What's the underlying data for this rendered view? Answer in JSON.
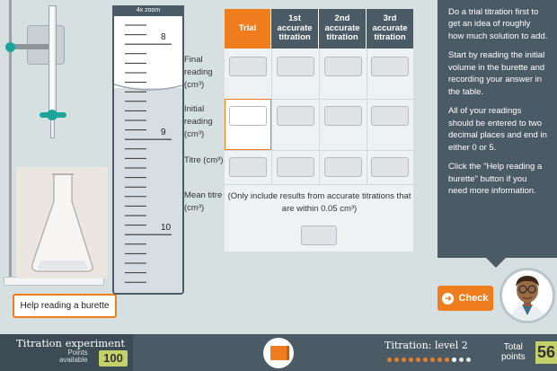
{
  "zoom": {
    "title": "4x zoom",
    "tick_labels": [
      "8",
      "9",
      "10"
    ]
  },
  "help_button": {
    "label": "Help reading a burette"
  },
  "table": {
    "headers": [
      "Trial",
      "1st accurate titration",
      "2nd accurate titration",
      "3rd accurate titration"
    ],
    "row_labels": {
      "final": "Final reading (cm³)",
      "initial": "Initial reading (cm³)",
      "titre": "Titre (cm³)",
      "mean": "Mean titre (cm³)"
    },
    "note": "(Only include results from accurate titrations that are within 0.05 cm³)",
    "values": {
      "final": [
        "",
        "",
        "",
        ""
      ],
      "initial": [
        "",
        "",
        "",
        ""
      ],
      "titre": [
        "",
        "",
        "",
        ""
      ],
      "mean": ""
    },
    "active_cell": "initial-trial"
  },
  "instructions": [
    "Do a trial titration first to get an idea of roughly how much solution to add.",
    "Start by reading the initial volume in the burette and recording your answer in the table.",
    "All of your readings should be entered to two decimal places and end in either 0 or 5.",
    "Click the \"Help reading a burette\" button if you need more information."
  ],
  "check_button": {
    "label": "Check",
    "icon": "arrow-right-icon"
  },
  "footer": {
    "title": "Titration experiment",
    "points_label_1": "Points",
    "points_label_2": "available",
    "points_available": "100",
    "level_label": "Titration: level 2",
    "total_label_1": "Total",
    "total_label_2": "points",
    "total_points": "56",
    "level_progress": [
      "done",
      "done",
      "done",
      "done",
      "done",
      "done",
      "done",
      "done",
      "done",
      "current",
      "todo",
      "todo"
    ]
  },
  "colors": {
    "accent": "#f07d1d",
    "panel": "#4b5b66",
    "badge": "#c3d16a",
    "teal": "#1aa49a"
  }
}
